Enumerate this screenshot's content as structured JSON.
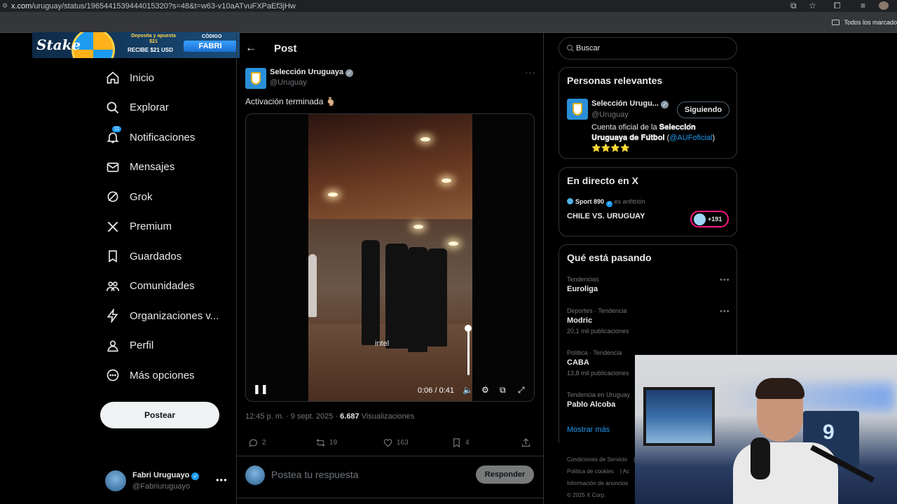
{
  "browser": {
    "url_domain": "x.com",
    "url_path": "/uruguay/status/1965441539444015320?s=48&t=w63-v10aATvuFXPaEf3jHw",
    "bookmarks_label": "Todos los marcado"
  },
  "ad": {
    "brand": "Stake",
    "promo_line1": "Deposita y apuesta $21",
    "promo_line2": "RECIBE $21 USD",
    "code_label": "CÓDIGO",
    "code": "FABRI"
  },
  "nav": {
    "items": [
      {
        "label": "Inicio",
        "icon": "home-icon"
      },
      {
        "label": "Explorar",
        "icon": "search-icon"
      },
      {
        "label": "Notificaciones",
        "icon": "bell-icon",
        "badge": "11"
      },
      {
        "label": "Mensajes",
        "icon": "mail-icon"
      },
      {
        "label": "Grok",
        "icon": "grok-icon"
      },
      {
        "label": "Premium",
        "icon": "x-logo-icon"
      },
      {
        "label": "Guardados",
        "icon": "bookmark-icon"
      },
      {
        "label": "Comunidades",
        "icon": "people-icon"
      },
      {
        "label": "Organizaciones v...",
        "icon": "bolt-icon"
      },
      {
        "label": "Perfil",
        "icon": "person-icon"
      },
      {
        "label": "Más opciones",
        "icon": "more-circle-icon"
      }
    ],
    "post_button": "Postear",
    "account": {
      "name": "Fabri Uruguayo",
      "handle": "@Fabriuruguayo"
    }
  },
  "main": {
    "header_title": "Post",
    "tweet": {
      "author_name": "Selección Uruguaya",
      "author_handle": "@Uruguay",
      "text": "Activación terminada 🫰🏼",
      "video": {
        "watermark": "intel",
        "time": "0:06 / 0:41",
        "volume_level": 1.0
      },
      "time_label": "12:45 p. m. · 9 sept. 2025 · ",
      "views_count": "6.687",
      "views_label": " Visualizaciones",
      "stats": {
        "replies": "2",
        "reposts": "19",
        "likes": "163",
        "bookmarks": "4"
      }
    },
    "reply": {
      "placeholder": "Postea tu respuesta",
      "button": "Responder"
    }
  },
  "right": {
    "search_placeholder": "Buscar",
    "relevant": {
      "title": "Personas relevantes",
      "name": "Selección Urugu...",
      "handle": "@Uruguay",
      "follow_label": "Siguiendo",
      "bio_pre": "Cuenta oficial de la ",
      "bio_bold": "𝐒𝐞𝐥𝐞𝐜𝐜𝐢𝐨́𝐧 𝐔𝐫𝐮𝐠𝐮𝐚𝐲𝐚 𝐝𝐞 𝐅𝐮́𝐭𝐛𝐨𝐥",
      "bio_link": "@AUFoficial",
      "bio_stars": "⭐⭐⭐⭐"
    },
    "live": {
      "title": "En directo en X",
      "host_name": "Sport 890",
      "host_suffix": " es anfitrión",
      "event": "CHILE VS. URUGUAY",
      "listeners": "+191"
    },
    "trending": {
      "title": "Qué está pasando",
      "items": [
        {
          "context": "Tendencias",
          "name": "Euroliga",
          "posts": ""
        },
        {
          "context": "Deportes · Tendencia",
          "name": "Modric",
          "posts": "20,1 mil publicaciones"
        },
        {
          "context": "Política · Tendencia",
          "name": "CABA",
          "posts": "13,8 mil publicaciones"
        },
        {
          "context": "Tendencia en Uruguay",
          "name": "Pablo Alcoba",
          "posts": ""
        }
      ],
      "show_more": "Mostrar más"
    },
    "footer": {
      "links": [
        "Condiciones de Servicio",
        "Política de cookies",
        "Información de anuncios",
        "© 2025 X Corp."
      ],
      "extra": [
        "|",
        "|  Ac"
      ]
    }
  },
  "webcam": {
    "shirt_number": "9"
  }
}
